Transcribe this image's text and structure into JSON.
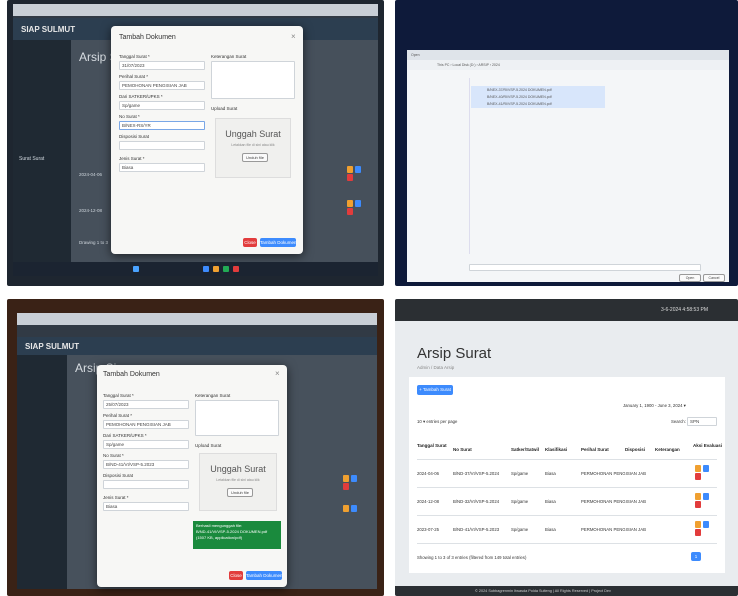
{
  "photos": {
    "top_left": {
      "app_brand": "SIAP SULMUT",
      "page_title": "Arsip Su",
      "sidebar_item": "Surat Surat",
      "dialog": {
        "title": "Tambah Dokumen",
        "close": "×",
        "tanggal_label": "Tanggal Surat *",
        "tanggal_value": "31/07/2023",
        "perihal_label": "Perihal Surat *",
        "perihal_value": "PEMOHONAN PENGISIAN JAB",
        "dari_label": "Dari SATKER/UPKS *",
        "dari_value": "Sp/game",
        "nomor_label": "No Surat *",
        "nomor_value": "B/NEX-RS/YR",
        "disposisi_label": "Disposisi Surat",
        "jenis_label": "Jenis Surat *",
        "jenis_value": "Biasa",
        "keterangan_label": "Keterangan Surat",
        "upload_label": "Upload Surat",
        "upload_title": "Unggah Surat",
        "upload_sub": "Letakkan file di sini atau klik",
        "upload_btn": "Unduh file",
        "close_btn": "Close",
        "save_btn": "Tambah Dokumen"
      },
      "table_dates": [
        "2024-04-06",
        "2024-12-08"
      ],
      "drawing": "Drawing 1 to 3"
    },
    "top_right": {
      "window_title": "Open",
      "path": "This PC › Local Disk (D:) › ARSIP › 2024",
      "files": [
        "B/NEX-37/RI/VSP-5.2024 DOKUMEN.pdf",
        "B/NEX-40/RI/VSP-5.2024 DOKUMEN.pdf",
        "B/NEX-41/RI/VSP-5.2024 DOKUMEN.pdf"
      ],
      "open_btn": "Open",
      "cancel_btn": "Cancel"
    },
    "bottom_left": {
      "app_brand": "SIAP SULMUT",
      "page_title": "Arsip Si",
      "dialog": {
        "title": "Tambah Dokumen",
        "close": "×",
        "tanggal_label": "Tanggal Surat *",
        "tanggal_value": "25/07/2023",
        "perihal_label": "Perihal Surat *",
        "perihal_value": "PEMOHONAN PENGISIAN JAB",
        "dari_label": "Dari SATKER/UPKS *",
        "dari_value": "Sp/game",
        "nomor_label": "No Surat *",
        "nomor_value": "B/ND-41/VI/VSP-5.2023",
        "disposisi_label": "Disposisi Surat",
        "jenis_label": "Jenis Surat *",
        "jenis_value": "Biasa",
        "keterangan_label": "Keterangan Surat",
        "upload_label": "Upload Surat",
        "upload_title": "Unggah Surat",
        "upload_sub": "Letakkan file di sini atau klik",
        "upload_btn": "Unduh file",
        "toast": "Berhasil mengunggah file:\nB/ND-41/VI/VSP-5.2024 DOKUMEN.pdf\n(1507 KB, application/pdf)",
        "close_btn": "Close",
        "save_btn": "Tambah Dokumen"
      }
    },
    "bottom_right": {
      "header_time": "3-6-2024 4:58:53 PM",
      "page_title": "Arsip Surat",
      "breadcrumb": "Admin / Data Arsip",
      "add_btn": "+ Tambah Surat",
      "date_range": "January 1, 1900 - June 3, 2024 ▾",
      "entries_label": "10  ▾ entries per page",
      "search_label": "Search:",
      "search_value": "SPN",
      "columns": [
        "Tanggal Surat",
        "No Surat",
        "Satker/Satwil",
        "Klasifikasi",
        "Perihal Surat",
        "Disposisi",
        "Keterangan",
        "Aksi Evaluasi"
      ],
      "rows": [
        {
          "tanggal": "2024-04-06",
          "no": "B/ND-37/VI/VSP-5.2024",
          "satker": "Sp/game",
          "klasifikasi": "Biasa",
          "perihal": "PERMOHONAN PENGISIAN JAB"
        },
        {
          "tanggal": "2024-12-08",
          "no": "B/ND-32/VI/VSP-5.2024",
          "satker": "Sp/game",
          "klasifikasi": "Biasa",
          "perihal": "PERMOHONAN PENGISIAN JAB"
        },
        {
          "tanggal": "2023-07-25",
          "no": "B/ND-41/VI/VSP-5.2023",
          "satker": "Sp/game",
          "klasifikasi": "Biasa",
          "perihal": "PERMOHONAN PENGISIAN JAB"
        }
      ],
      "footer_info": "Showing 1 to 3 of 3 entries (filtered from 149 total entries)",
      "pagination_current": "1",
      "copyright": "© 2024 Subbagrenmin Itwasda Polda Sulteng | All Rights Reserved | Project Dev"
    }
  }
}
